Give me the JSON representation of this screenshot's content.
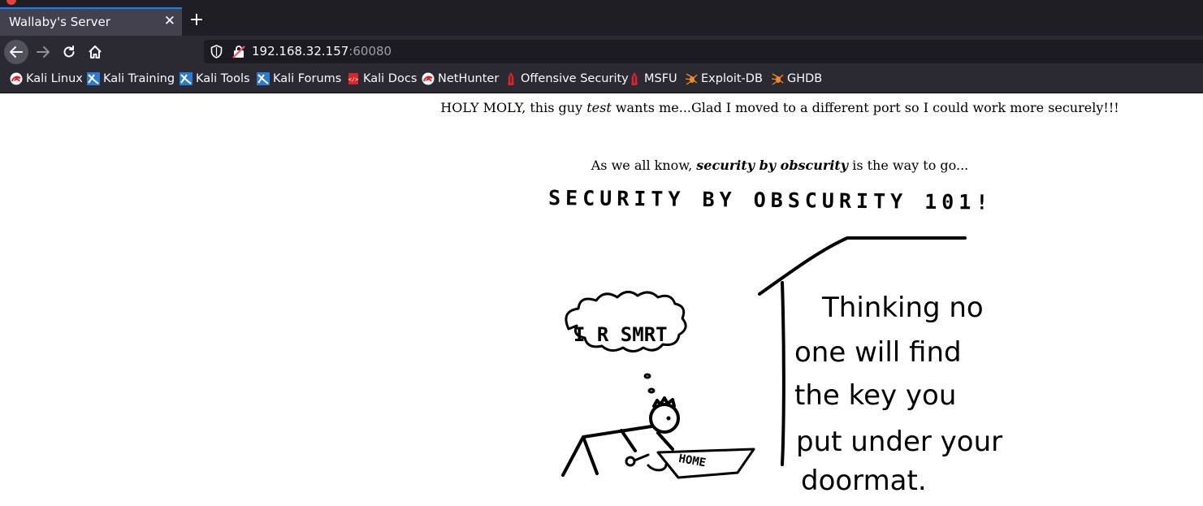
{
  "tab": {
    "title": "Wallaby's Server",
    "close_label": "✕",
    "new_tab_label": "+"
  },
  "url": {
    "host": "192.168.32.157",
    "port": ":60080"
  },
  "bookmarks": [
    {
      "label": "Kali Linux",
      "icon": "kali-dragon-icon"
    },
    {
      "label": "Kali Training",
      "icon": "kali-training-icon"
    },
    {
      "label": "Kali Tools",
      "icon": "kali-tools-icon"
    },
    {
      "label": "Kali Forums",
      "icon": "kali-forums-icon"
    },
    {
      "label": "Kali Docs",
      "icon": "kali-docs-icon"
    },
    {
      "label": "NetHunter",
      "icon": "nethunter-icon"
    },
    {
      "label": "Offensive Security",
      "icon": "offsec-icon"
    },
    {
      "label": "MSFU",
      "icon": "msfu-icon"
    },
    {
      "label": "Exploit-DB",
      "icon": "exploitdb-icon"
    },
    {
      "label": "GHDB",
      "icon": "ghdb-icon"
    }
  ],
  "page": {
    "line1_a": "HOLY MOLY, this guy ",
    "line1_em": "test",
    "line1_b": " wants me...Glad I moved to a different port so I could work more securely!!!",
    "line2_a": "As we all know, ",
    "line2_strong": "security by obscurity",
    "line2_b": " is the way to go...",
    "comic": {
      "title": "SECURITY BY OBSCURITY 101!",
      "thought": "I R SMRT",
      "doormat": "HOME",
      "caption_lines": [
        "Thinking no",
        "one will find",
        "the key you",
        "put under your",
        "doormat."
      ]
    }
  }
}
